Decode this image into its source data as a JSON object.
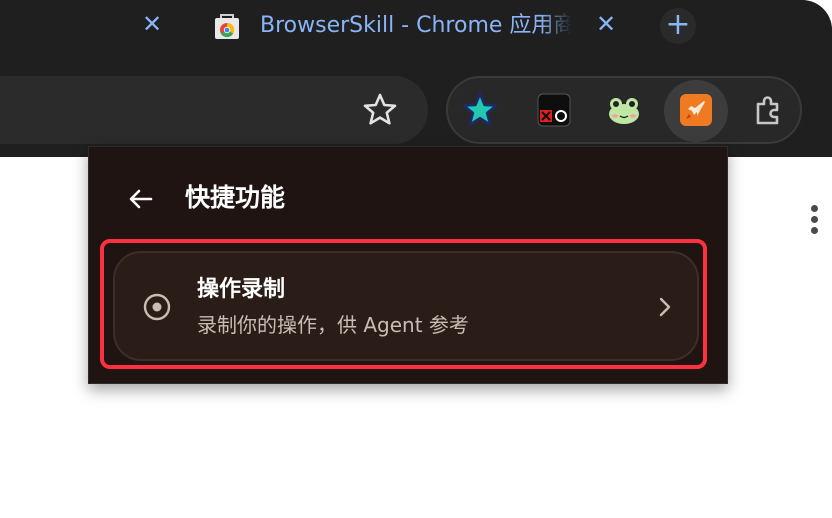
{
  "tabstrip": {
    "prev_tab_close_label": "✕",
    "active_tab_title": "BrowserSkill - Chrome 应用商店",
    "active_tab_close_label": "✕",
    "new_tab_label": "+"
  },
  "toolbar": {
    "bookmark_icon": "star-outline-icon",
    "extensions": [
      {
        "name": "teal-star-extension-icon"
      },
      {
        "name": "red-dot-recorder-extension-icon"
      },
      {
        "name": "frog-extension-icon"
      },
      {
        "name": "rocket-browserskill-extension-icon"
      },
      {
        "name": "puzzle-extensions-menu-icon"
      }
    ]
  },
  "popup": {
    "back_icon": "arrow-left-icon",
    "title": "快捷功能",
    "feature": {
      "icon": "record-circle-icon",
      "title": "操作录制",
      "description": "录制你的操作，供 Agent 参考",
      "chevron": "chevron-right-icon"
    }
  },
  "colors": {
    "tab_accent": "#8ab4f8",
    "popup_bg": "#1f1411",
    "card_bg": "#2a1d18",
    "highlight": "#ff3040"
  }
}
